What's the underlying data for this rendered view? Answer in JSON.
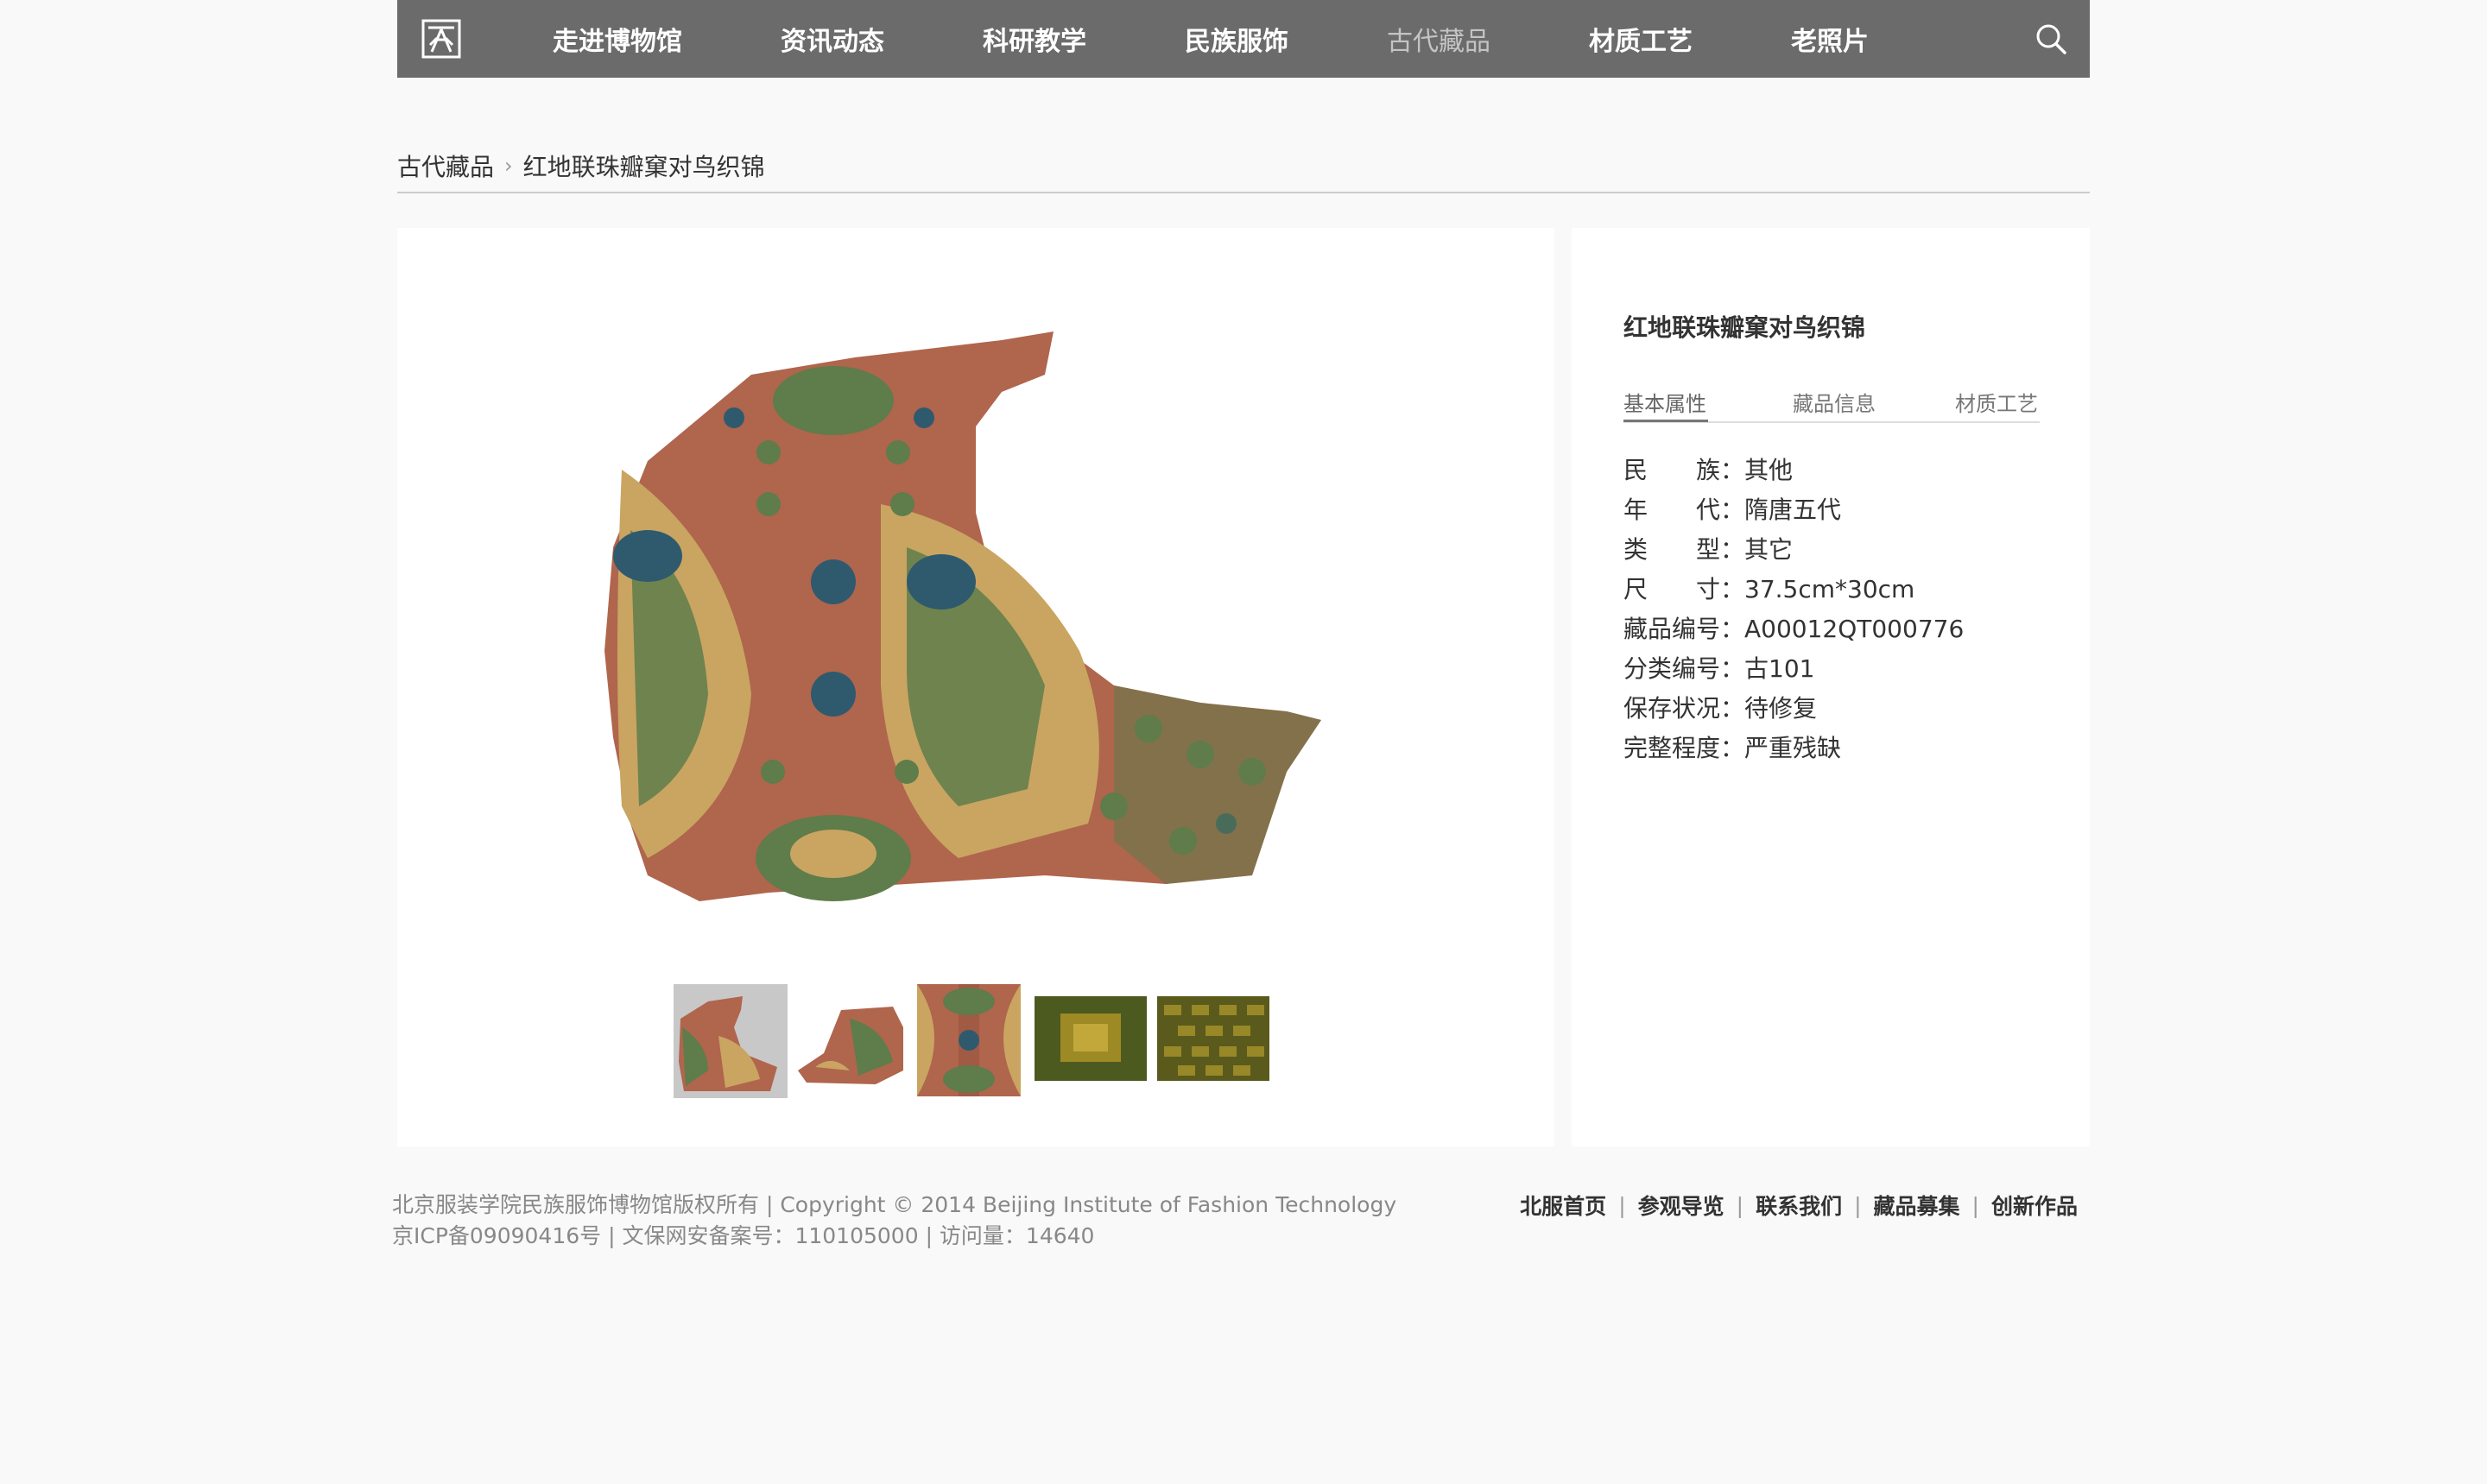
{
  "nav": {
    "items": [
      {
        "label": "走进博物馆"
      },
      {
        "label": "资讯动态"
      },
      {
        "label": "科研教学"
      },
      {
        "label": "民族服饰"
      },
      {
        "label": "古代藏品",
        "active": true
      },
      {
        "label": "材质工艺"
      },
      {
        "label": "老照片"
      }
    ],
    "bg_color": "#6b6b6b"
  },
  "breadcrumb": {
    "parent": "古代藏品",
    "current": "红地联珠瓣窠对鸟织锦"
  },
  "item": {
    "title": "红地联珠瓣窠对鸟织锦",
    "tabs": [
      "基本属性",
      "藏品信息",
      "材质工艺"
    ],
    "properties": [
      {
        "key_left": "民",
        "key_right": "族",
        "value": "其他"
      },
      {
        "key_left": "年",
        "key_right": "代",
        "value": "隋唐五代"
      },
      {
        "key_left": "类",
        "key_right": "型",
        "value": "其它"
      },
      {
        "key_left": "尺",
        "key_right": "寸",
        "value": "37.5cm*30cm"
      },
      {
        "key": "藏品编号",
        "value": "A00012QT000776"
      },
      {
        "key": "分类编号",
        "value": "古101"
      },
      {
        "key": "保存状况",
        "value": "待修复"
      },
      {
        "key": "完整程度",
        "value": "严重残缺"
      }
    ],
    "thumbnails": [
      "thumbnail-1",
      "thumbnail-2",
      "thumbnail-3",
      "thumbnail-4",
      "thumbnail-5"
    ]
  },
  "footer": {
    "line1": "北京服装学院民族服饰博物馆版权所有 | Copyright © 2014 Beijing Institute of Fashion Technology",
    "line2": "京ICP备09090416号 | 文保网安备案号：110105000 | 访问量：14640",
    "links": [
      "北服首页",
      "参观导览",
      "联系我们",
      "藏品募集",
      "创新作品"
    ]
  },
  "colors": {
    "fabric_red": "#b0654d",
    "fabric_green": "#5f7c4b",
    "fabric_blue": "#2f5a6e",
    "fabric_tan": "#c9a561"
  }
}
